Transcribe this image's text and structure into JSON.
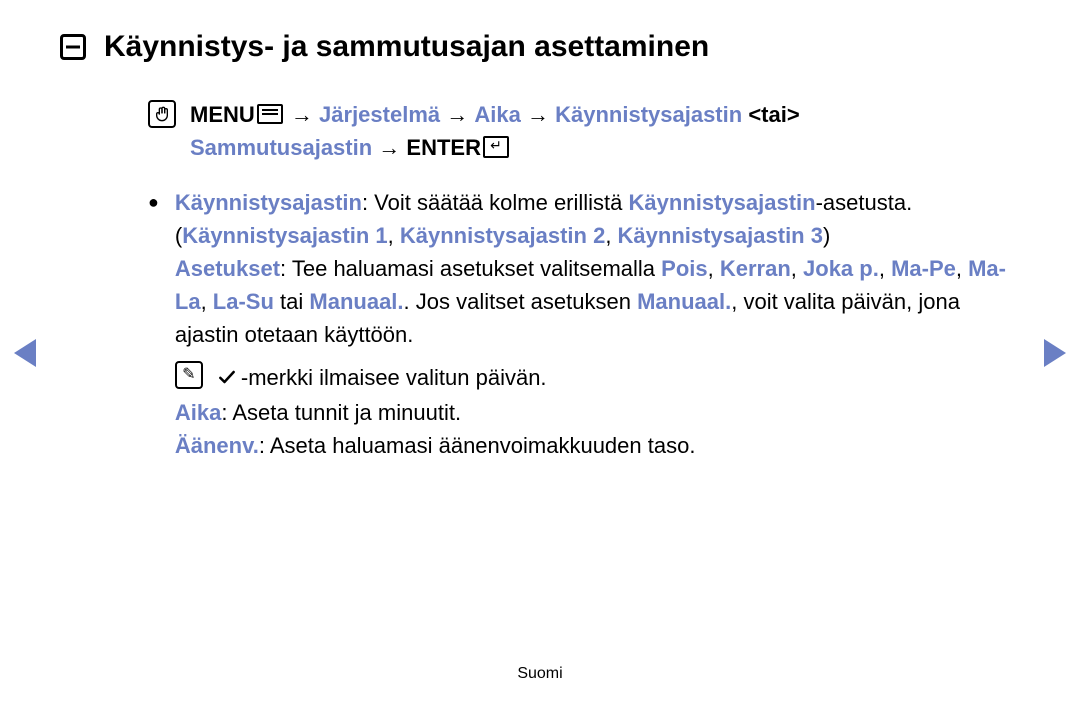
{
  "title": "Käynnistys- ja sammutusajan asettaminen",
  "breadcrumb": {
    "menu_label": "MENU",
    "path1": "Järjestelmä",
    "path2": "Aika",
    "path3": "Käynnistysajastin",
    "or_token": "<tai>",
    "path4": "Sammutusajastin",
    "enter_label": "ENTER",
    "arrow": "→"
  },
  "body": {
    "on_timer_label": "Käynnistysajastin",
    "on_timer_desc_1": ": Voit säätää kolme erillistä ",
    "on_timer_ref": "Käynnistysajastin",
    "on_timer_desc_2": "-asetusta.",
    "timers_open": "(",
    "timer1": "Käynnistysajastin 1",
    "sep": ", ",
    "timer2": "Käynnistysajastin 2",
    "timer3": "Käynnistysajastin 3",
    "timers_close": ")",
    "settings_label": "Asetukset",
    "settings_desc_1": ": Tee haluamasi asetukset valitsemalla ",
    "opt_off": "Pois",
    "opt_once": "Kerran",
    "opt_everyday": "Joka p.",
    "opt_monfri": "Ma-Pe",
    "opt_monsat": "Ma-La",
    "opt_satsun": "La-Su",
    "or_word": " tai ",
    "opt_manual": "Manuaal.",
    "settings_desc_2": ". Jos valitset asetuksen ",
    "opt_manual2": "Manuaal.",
    "settings_desc_3": ", voit valita päivän, jona ajastin otetaan käyttöön.",
    "note_text": "-merkki ilmaisee valitun päivän.",
    "aika_label": "Aika",
    "aika_desc": ": Aseta tunnit ja minuutit.",
    "vol_label": "Äänenv.",
    "vol_desc": ": Aseta haluamasi äänenvoimakkuuden taso."
  },
  "footer": "Suomi"
}
